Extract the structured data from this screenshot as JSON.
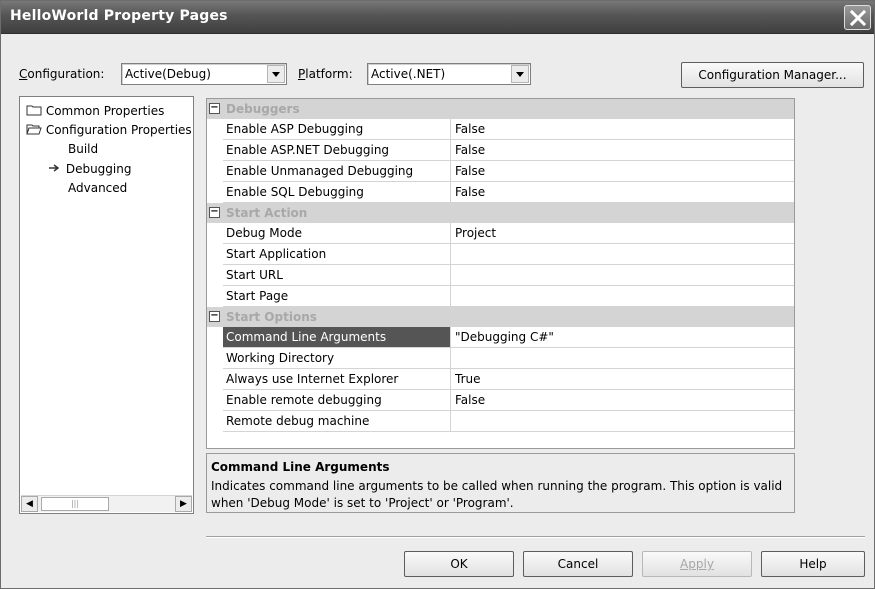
{
  "window": {
    "title": "HelloWorld Property Pages"
  },
  "toolbar": {
    "configuration_label": "Configuration:",
    "configuration_value": "Active(Debug)",
    "platform_label": "Platform:",
    "platform_value": "Active(.NET)",
    "config_manager_label": "Configuration Manager..."
  },
  "tree": {
    "items": [
      {
        "label": "Common Properties",
        "icon": "folder-icon"
      },
      {
        "label": "Configuration Properties",
        "icon": "folder-open-icon"
      },
      {
        "label": "Build"
      },
      {
        "label": "Debugging",
        "icon": "arrow-right-icon"
      },
      {
        "label": "Advanced"
      }
    ]
  },
  "grid": {
    "categories": [
      {
        "label": "Debuggers",
        "rows": [
          {
            "name": "Enable ASP Debugging",
            "value": "False"
          },
          {
            "name": "Enable ASP.NET Debugging",
            "value": "False"
          },
          {
            "name": "Enable Unmanaged Debugging",
            "value": "False"
          },
          {
            "name": "Enable SQL Debugging",
            "value": "False"
          }
        ]
      },
      {
        "label": "Start Action",
        "rows": [
          {
            "name": "Debug Mode",
            "value": "Project"
          },
          {
            "name": "Start Application",
            "value": ""
          },
          {
            "name": "Start URL",
            "value": ""
          },
          {
            "name": "Start Page",
            "value": ""
          }
        ]
      },
      {
        "label": "Start Options",
        "rows": [
          {
            "name": "Command Line Arguments",
            "value": "\"Debugging C#\"",
            "selected": true
          },
          {
            "name": "Working Directory",
            "value": ""
          },
          {
            "name": "Always use Internet Explorer",
            "value": "True"
          },
          {
            "name": "Enable remote debugging",
            "value": "False"
          },
          {
            "name": "Remote debug machine",
            "value": ""
          }
        ]
      }
    ]
  },
  "description": {
    "title": "Command Line Arguments",
    "text": "Indicates command line arguments to be called when running the program. This option is valid when 'Debug Mode' is set to 'Project' or 'Program'."
  },
  "buttons": {
    "ok": "OK",
    "cancel": "Cancel",
    "apply": "Apply",
    "help": "Help"
  },
  "colors": {
    "titlebar": "#555555",
    "selected_row": "#555555",
    "category_row": "#d4d4d4"
  }
}
